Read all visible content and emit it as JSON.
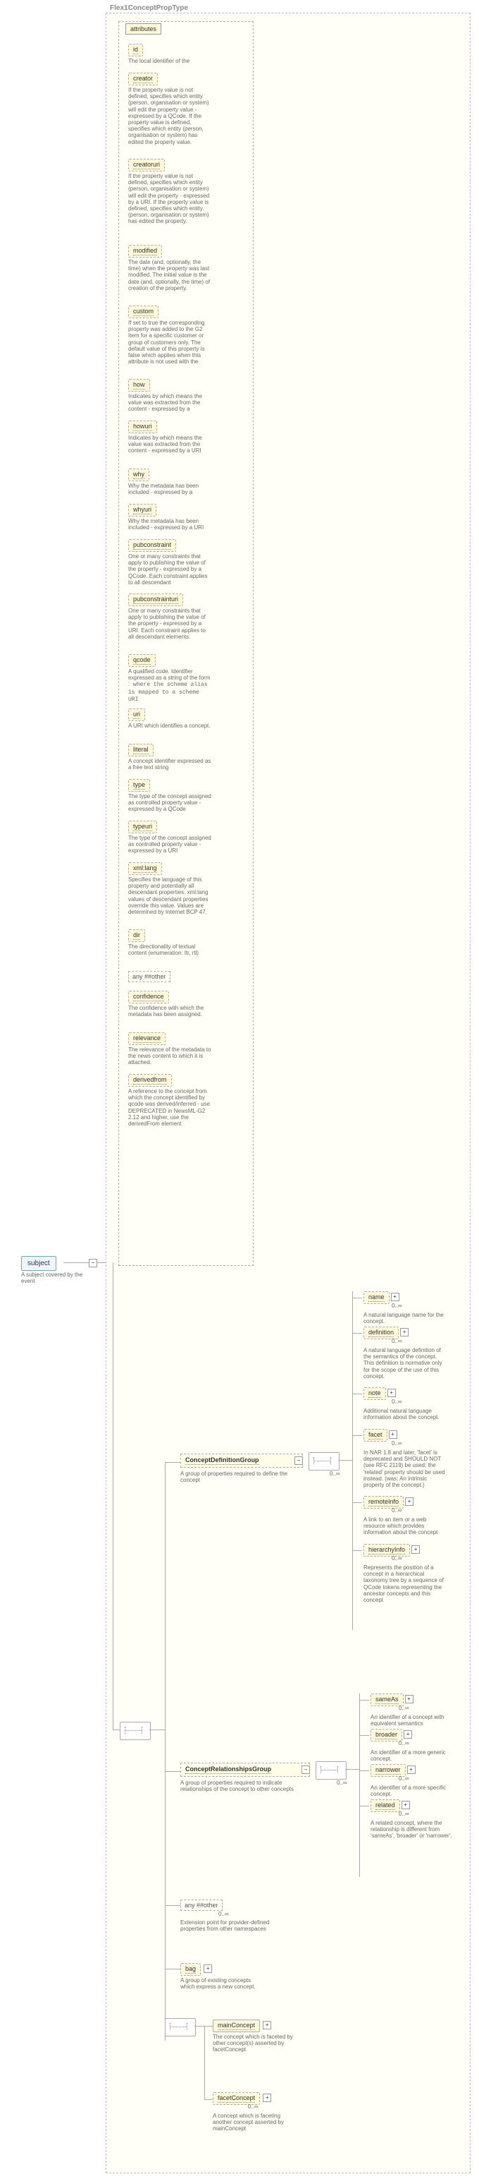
{
  "type_label": "Flex1ConceptPropType",
  "subject": {
    "label": "subject",
    "desc": "A subject covered by the event"
  },
  "attributes_header": "attributes",
  "attrs": [
    {
      "name": "id",
      "desc": "The local identifier of the"
    },
    {
      "name": "creator",
      "desc": "If the property value is not defined, specifies which entity (person, organisation or system) will edit the property value - expressed by a QCode. If the property value is defined, specifies which entity (person, organisation or system) has edited the property value."
    },
    {
      "name": "creatoruri",
      "desc": "If the property value is not defined, specifies which entity (person, organisation or system) will edit the property - expressed by a URI. If the property value is defined, specifies which entity (person, organisation or system) has edited the property."
    },
    {
      "name": "modified",
      "desc": "The date (and, optionally, the time) when the property was last modified. The initial value is the date (and, optionally, the time) of creation of the property."
    },
    {
      "name": "custom",
      "desc": "If set to true the corresponding property was added to the G2 Item for a specific customer or group of customers only. The default value of this property is false which applies when this attribute is not used with the"
    },
    {
      "name": "how",
      "desc": "Indicates by which means the value was extracted from the content - expressed by a"
    },
    {
      "name": "howuri",
      "desc": "Indicates by which means the value was extracted from the content - expressed by a URI"
    },
    {
      "name": "why",
      "desc": "Why the metadata has been included - expressed by a"
    },
    {
      "name": "whyuri",
      "desc": "Why the metadata has been included - expressed by a URI"
    },
    {
      "name": "pubconstraint",
      "desc": "One or many constraints that apply to publishing the value of the property - expressed by a QCode. Each constraint applies to all descendant"
    },
    {
      "name": "pubconstrainturi",
      "desc": "One or many constraints that apply to publishing the value of the property - expressed by a URI. Each constraint applies to all descendant elements."
    },
    {
      "name": "qcode",
      "desc": "A qualified code. Identifier expressed as a string of the form <scheme-alias>:<code> where the scheme alias is mapped to a scheme URI"
    },
    {
      "name": "uri",
      "desc": "A URI which identifies a concept."
    },
    {
      "name": "literal",
      "desc": "A concept identifier expressed as a free text string"
    },
    {
      "name": "type",
      "desc": "The type of the concept assigned as controlled property value - expressed by a QCode"
    },
    {
      "name": "typeuri",
      "desc": "The type of the concept assigned as controlled property value - expressed by a URI"
    },
    {
      "name": "xml:lang",
      "desc": "Specifies the language of this property and potentially all descendant properties. xml:lang values of descendant properties override this value. Values are determined by Internet BCP 47."
    },
    {
      "name": "dir",
      "desc": "The directionality of textual content (enumeration: ltr, rtl)"
    }
  ],
  "any_attr": "any ##other",
  "post_attrs": [
    {
      "name": "confidence",
      "desc": "The confidence with which the metadata has been assigned."
    },
    {
      "name": "relevance",
      "desc": "The relevance of the metadata to the news content to which it is attached."
    },
    {
      "name": "derivedfrom",
      "desc": "A reference to the concept from which the concept identified by qcode was derived/inferred - use DEPRECATED in NewsML-G2 2.12 and higher, use the derivedFrom element"
    }
  ],
  "cdg": {
    "title": "ConceptDefinitionGroup",
    "desc": "A group of properties required to define the concept",
    "items": [
      {
        "name": "name",
        "desc": "A natural language name for the concept."
      },
      {
        "name": "definition",
        "desc": "A natural language definition of the semantics of the concept. This definition is normative only for the scope of the use of this concept."
      },
      {
        "name": "note",
        "desc": "Additional natural language information about the concept."
      },
      {
        "name": "facet",
        "desc": "In NAR 1.8 and later, 'facet' is deprecated and SHOULD NOT (see RFC 2119) be used; the 'related' property should be used instead. (was: An intrinsic property of the concept.)"
      },
      {
        "name": "remoteInfo",
        "desc": "A link to an item or a web resource which provides information about the concept"
      },
      {
        "name": "hierarchyInfo",
        "desc": "Represents the position of a concept in a hierarchical taxonomy tree by a sequence of QCode tokens representing the ancestor concepts and this concept"
      }
    ]
  },
  "crg": {
    "title": "ConceptRelationshipsGroup",
    "desc": "A group of properties required to indicate relationships of the concept to other concepts",
    "items": [
      {
        "name": "sameAs",
        "desc": "An identifier of a concept with equivalent semantics"
      },
      {
        "name": "broader",
        "desc": "An identifier of a more generic concept."
      },
      {
        "name": "narrower",
        "desc": "An identifier of a more specific concept."
      },
      {
        "name": "related",
        "desc": "A related concept, where the relationship is different from 'sameAs', 'broader' or 'narrower'."
      }
    ]
  },
  "any_el": {
    "label": "any ##other",
    "desc": "Extension point for provider-defined properties from other namespaces"
  },
  "bag": {
    "name": "bag",
    "desc": "A group of existing concepts which express a new concept."
  },
  "main": {
    "name": "mainConcept",
    "desc": "The concept which is faceted by other concept(s) asserted by facetConcept"
  },
  "facet": {
    "name": "facetConcept",
    "desc": "A concept which is faceting another concept asserted by mainConcept"
  },
  "card": "0..∞"
}
